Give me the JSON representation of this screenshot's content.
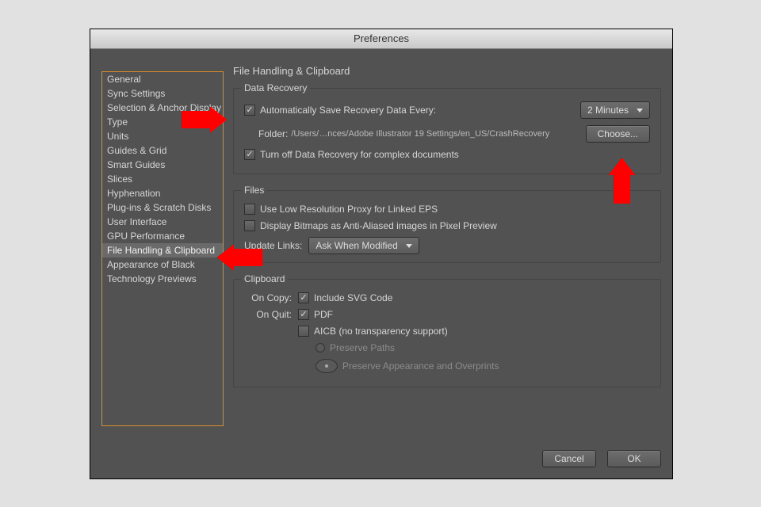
{
  "title": "Preferences",
  "sidebar": {
    "items": [
      {
        "label": "General"
      },
      {
        "label": "Sync Settings"
      },
      {
        "label": "Selection & Anchor Display"
      },
      {
        "label": "Type"
      },
      {
        "label": "Units"
      },
      {
        "label": "Guides & Grid"
      },
      {
        "label": "Smart Guides"
      },
      {
        "label": "Slices"
      },
      {
        "label": "Hyphenation"
      },
      {
        "label": "Plug-ins & Scratch Disks"
      },
      {
        "label": "User Interface"
      },
      {
        "label": "GPU Performance"
      },
      {
        "label": "File Handling & Clipboard"
      },
      {
        "label": "Appearance of Black"
      },
      {
        "label": "Technology Previews"
      }
    ],
    "selectedIndex": 12
  },
  "content": {
    "header": "File Handling & Clipboard",
    "dataRecovery": {
      "legend": "Data Recovery",
      "autoSave": {
        "checked": true,
        "label": "Automatically Save Recovery Data Every:"
      },
      "interval": {
        "value": "2 Minutes"
      },
      "folderLabel": "Folder:",
      "folderPath": "/Users/…nces/Adobe Illustrator 19 Settings/en_US/CrashRecovery",
      "chooseLabel": "Choose...",
      "turnOff": {
        "checked": true,
        "label": "Turn off Data Recovery for complex documents"
      }
    },
    "files": {
      "legend": "Files",
      "lowResProxy": {
        "checked": false,
        "label": "Use Low Resolution Proxy for Linked EPS"
      },
      "displayBitmaps": {
        "checked": false,
        "label": "Display Bitmaps as Anti-Aliased images in Pixel Preview"
      },
      "updateLinksLabel": "Update Links:",
      "updateLinksValue": "Ask When Modified"
    },
    "clipboard": {
      "legend": "Clipboard",
      "onCopyLabel": "On Copy:",
      "includeSvg": {
        "checked": true,
        "label": "Include SVG Code"
      },
      "onQuitLabel": "On Quit:",
      "pdf": {
        "checked": true,
        "label": "PDF"
      },
      "aicb": {
        "checked": false,
        "label": "AICB (no transparency support)"
      },
      "preservePaths": {
        "label": "Preserve Paths",
        "selected": false
      },
      "preserveAppearance": {
        "label": "Preserve Appearance and Overprints",
        "selected": true
      }
    }
  },
  "footer": {
    "cancel": "Cancel",
    "ok": "OK"
  }
}
